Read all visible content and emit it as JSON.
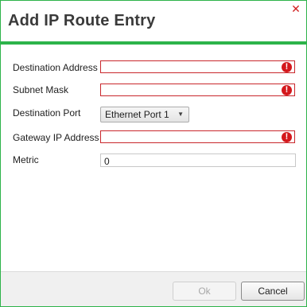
{
  "dialog": {
    "title": "Add IP Route Entry",
    "close_glyph": "✕"
  },
  "form": {
    "destination_address": {
      "label": "Destination Address",
      "value": "",
      "error_glyph": "!"
    },
    "subnet_mask": {
      "label": "Subnet Mask",
      "value": "",
      "error_glyph": "!"
    },
    "destination_port": {
      "label": "Destination Port",
      "selected": "Ethernet Port 1",
      "arrow": "▼"
    },
    "gateway_ip": {
      "label": "Gateway IP Address",
      "value": "",
      "error_glyph": "!"
    },
    "metric": {
      "label": "Metric",
      "value": "0"
    }
  },
  "buttons": {
    "ok": "Ok",
    "cancel": "Cancel"
  },
  "colors": {
    "accent": "#2db34a",
    "error": "#d4181c",
    "close": "#d11f1f"
  }
}
